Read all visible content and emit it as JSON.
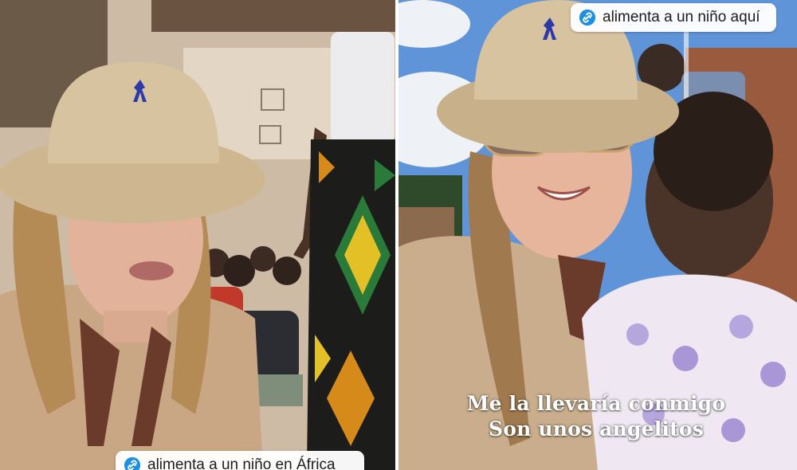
{
  "left_panel": {
    "link_sticker": {
      "text": "alimenta a un niño en África",
      "icon": "link-icon"
    }
  },
  "right_panel": {
    "link_sticker": {
      "text": "alimenta a un niño aquí",
      "icon": "link-icon"
    },
    "caption": {
      "line1": "Me la llevaría conmigo",
      "line2": "Son unos angelitos"
    }
  },
  "colors": {
    "link_icon": "#1f8fe0",
    "hat": "#d8c3a0",
    "polo_logo": "#2b3aa8",
    "caption_text": "#ffffff"
  }
}
